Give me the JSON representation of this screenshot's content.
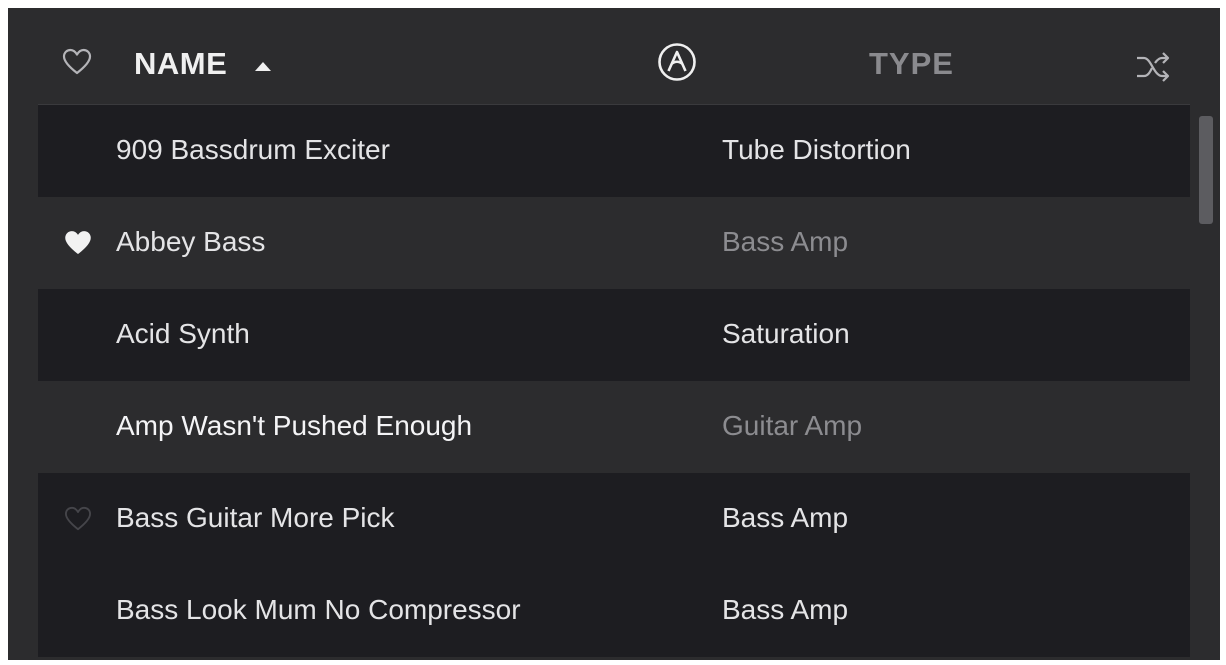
{
  "header": {
    "name_label": "NAME",
    "type_label": "TYPE",
    "sort_direction": "ascending",
    "icons": {
      "favorite": "heart-outline-icon",
      "sort": "sort-ascending-icon",
      "brand": "arturia-logo-icon",
      "shuffle": "shuffle-icon"
    }
  },
  "rows": [
    {
      "name": "909 Bassdrum Exciter",
      "type": "Tube Distortion",
      "favorite": "none"
    },
    {
      "name": "Abbey Bass",
      "type": "Bass Amp",
      "favorite": "filled"
    },
    {
      "name": "Acid Synth",
      "type": "Saturation",
      "favorite": "none"
    },
    {
      "name": "Amp Wasn't Pushed Enough",
      "type": "Guitar Amp",
      "favorite": "none"
    },
    {
      "name": "Bass Guitar More Pick",
      "type": "Bass Amp",
      "favorite": "outline"
    },
    {
      "name": "Bass Look Mum No Compressor",
      "type": "Bass Amp",
      "favorite": "none"
    }
  ],
  "colors": {
    "panel_bg": "#2c2c2e",
    "row_dark_bg": "#1d1d21",
    "text_primary": "#e4e4e6",
    "text_muted": "#8c8c90",
    "scroll_thumb": "#5c5c60"
  }
}
